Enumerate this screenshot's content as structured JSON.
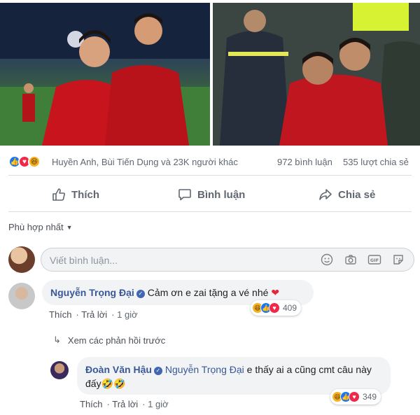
{
  "post": {
    "reactions": {
      "names": "Huyền Anh, Bùi Tiến Dụng và 23K người khác",
      "comments": "972 bình luận",
      "shares": "535 lượt chia sẻ"
    },
    "actions": {
      "like": "Thích",
      "comment": "Bình luận",
      "share": "Chia sẻ"
    }
  },
  "comments_section": {
    "sort_label": "Phù hợp nhất",
    "compose_placeholder": "Viết bình luận...",
    "comment1": {
      "author": "Nguyễn Trọng Đại",
      "text": "Cảm ơn e zai tặng a vé nhé",
      "like": "Thích",
      "reply": "Trả lời",
      "time": "1 giờ",
      "reaction_count": "409"
    },
    "view_previous": "Xem các phản hồi trước",
    "comment2": {
      "author": "Đoàn Văn Hậu",
      "mention": "Nguyễn Trọng Đại",
      "text": "e thấy ai a cũng cmt câu này đấy",
      "like": "Thích",
      "reply": "Trả lời",
      "time": "1 giờ",
      "reaction_count": "349"
    }
  },
  "colors": {
    "link": "#385898",
    "like_blue": "#1877f2",
    "love_red": "#f0284a",
    "haha_yellow": "#f7b125",
    "bubble": "#f2f3f5"
  }
}
